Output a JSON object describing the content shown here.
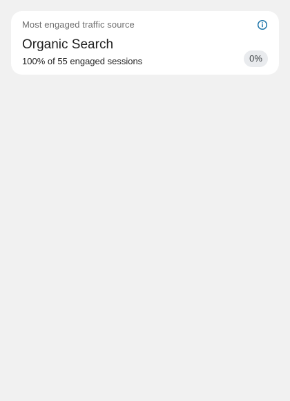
{
  "card": {
    "title": "Most engaged traffic source",
    "info_icon": "info-icon",
    "metric_name": "Organic Search",
    "metric_detail": "100% of 55 engaged sessions",
    "change": "0%"
  },
  "colors": {
    "page_background": "#f1f1f1",
    "card_background": "#ffffff",
    "info_icon": "#1a73a8",
    "chip_background": "#e9ebee"
  }
}
